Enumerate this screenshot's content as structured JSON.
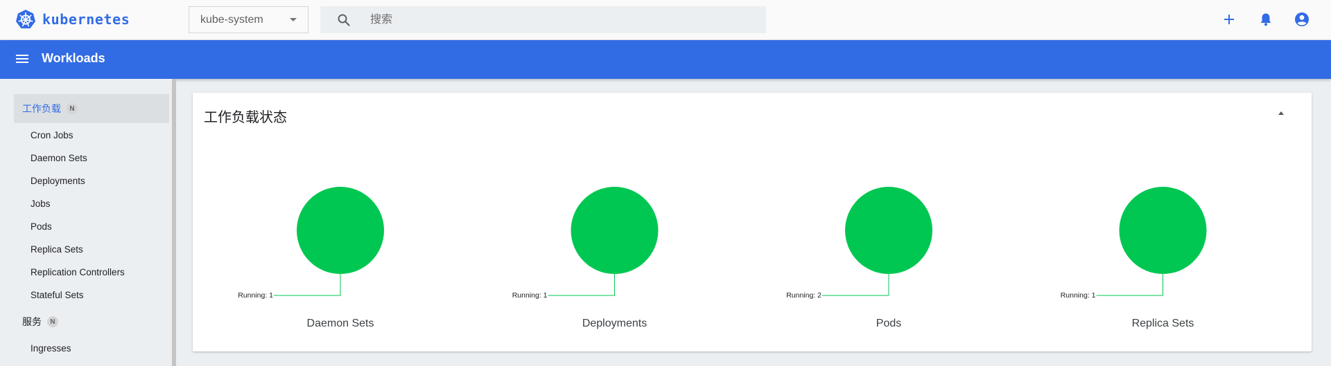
{
  "brand": {
    "name": "kubernetes"
  },
  "namespace": {
    "selected": "kube-system"
  },
  "search": {
    "placeholder": "搜索"
  },
  "header": {
    "title": "Workloads"
  },
  "sidebar": {
    "sections": [
      {
        "label": "工作负载",
        "badge": "N",
        "active": true
      },
      {
        "label": "服务",
        "badge": "N",
        "active": false
      }
    ],
    "workload_items": [
      "Cron Jobs",
      "Daemon Sets",
      "Deployments",
      "Jobs",
      "Pods",
      "Replica Sets",
      "Replication Controllers",
      "Stateful Sets"
    ],
    "service_items": [
      "Ingresses"
    ]
  },
  "card": {
    "title": "工作负载状态"
  },
  "colors": {
    "brand": "#326ce5",
    "running": "#00c752"
  },
  "chart_data": {
    "type": "pie",
    "charts": [
      {
        "title": "Daemon Sets",
        "slices": [
          {
            "label": "Running",
            "value": 1
          }
        ]
      },
      {
        "title": "Deployments",
        "slices": [
          {
            "label": "Running",
            "value": 1
          }
        ]
      },
      {
        "title": "Pods",
        "slices": [
          {
            "label": "Running",
            "value": 2
          }
        ]
      },
      {
        "title": "Replica Sets",
        "slices": [
          {
            "label": "Running",
            "value": 1
          }
        ]
      }
    ]
  }
}
